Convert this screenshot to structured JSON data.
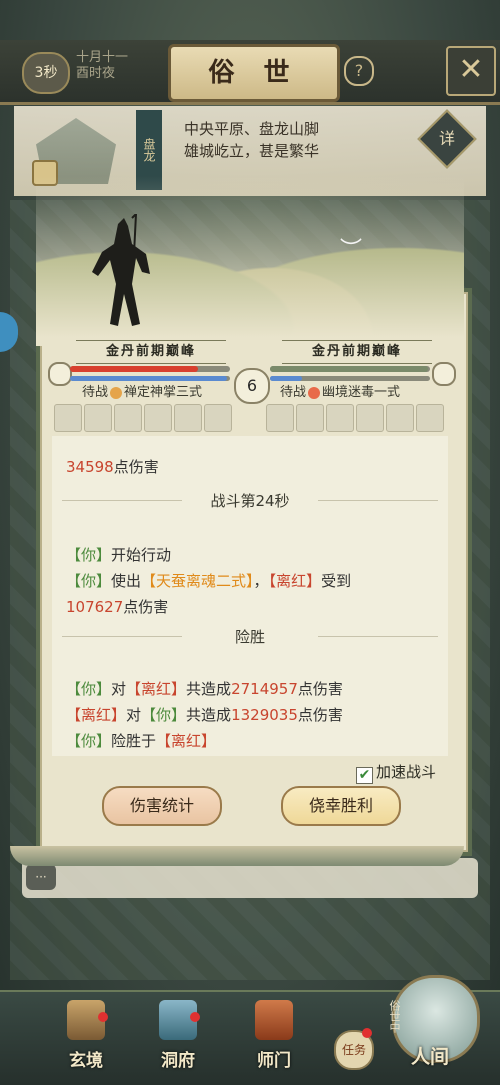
{
  "header": {
    "timer": "3秒",
    "date_line1": "十月十一",
    "date_line2": "酉时夜",
    "title": "俗 世",
    "help": "?",
    "close": "✕"
  },
  "location": {
    "tag": "盘龙",
    "desc_line1": "中央平原、盘龙山脚",
    "desc_line2": "雄城屹立，甚是繁华",
    "detail": "详"
  },
  "battle": {
    "left": {
      "realm": "金丹前期巅峰",
      "status_prefix": "待战",
      "skill": "禅定神掌三式",
      "hp_fraction": 0.8,
      "mp_fraction": 0.98
    },
    "right": {
      "realm": "金丹前期巅峰",
      "status_prefix": "待战",
      "skill": "幽境迷毒一式",
      "hp_fraction": 0.99,
      "mp_fraction": 0.2
    },
    "round": "6"
  },
  "log": {
    "partial_damage": "34598",
    "partial_suffix": "点伤害",
    "sep1": "战斗第24秒",
    "you": "【你】",
    "act": "开始行动",
    "use": "使出",
    "skill_used": "【天蚕离魂二式】",
    "comma": "，",
    "enemy": "【离红】",
    "received": "受到",
    "damage": "107627",
    "damage_suffix": "点伤害",
    "sep2": "险胜",
    "sum1_pre": "对",
    "sum1_mid": "共造成",
    "sum1_val": "2714957",
    "sum1_suf": "点伤害",
    "sum2_val": "1329035",
    "win_text": "险胜于"
  },
  "controls": {
    "speed_label": "加速战斗",
    "speed_checked": true,
    "stats_button": "伤害统计",
    "result_button": "侥幸胜利"
  },
  "nav": {
    "items": [
      "玄境",
      "洞府",
      "师门",
      "人间"
    ],
    "task": "任务",
    "world_label": "俗世中"
  },
  "colors": {
    "you": "#4c8a3c",
    "enemy": "#c8452e",
    "skill": "#e08a1a"
  }
}
